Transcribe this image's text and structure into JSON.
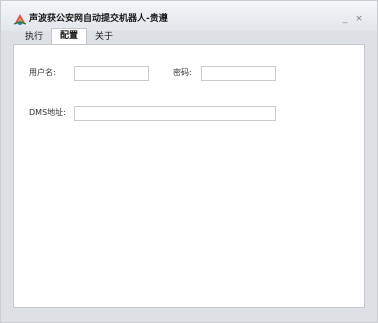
{
  "window": {
    "title": "声波获公安网自动提交机器人-贵遵",
    "minimize_glyph": "_",
    "close_glyph": "×"
  },
  "tabs": [
    {
      "label": "执行",
      "active": false
    },
    {
      "label": "配置",
      "active": true
    },
    {
      "label": "关于",
      "active": false
    }
  ],
  "form": {
    "username_label": "用户名:",
    "username_value": "",
    "password_label": "密码:",
    "password_value": "",
    "dms_label": "DMS地址:",
    "dms_value": ""
  },
  "icons": {
    "app": "app-logo-icon"
  }
}
